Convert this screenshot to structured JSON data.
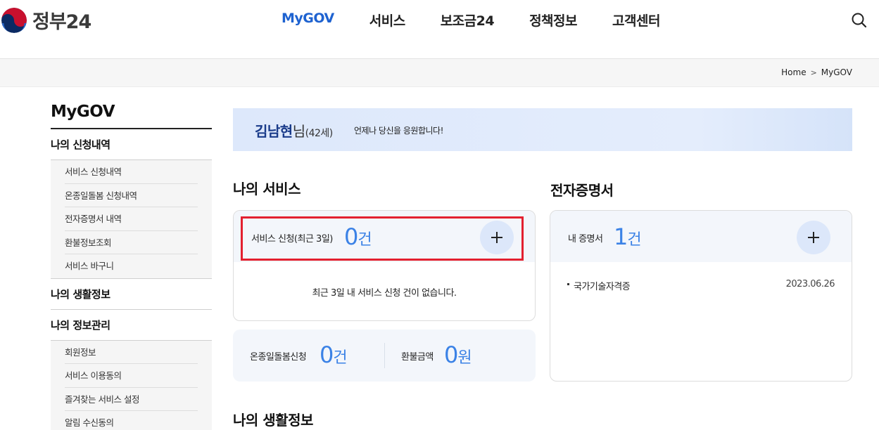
{
  "header": {
    "logo_text": "정부24",
    "nav": [
      "MyGOV",
      "서비스",
      "보조금24",
      "정책정보",
      "고객센터"
    ],
    "active_nav": "MyGOV",
    "search_icon": "search-icon"
  },
  "breadcrumb": {
    "home": "Home",
    "current": "MyGOV"
  },
  "sidebar": {
    "title": "MyGOV",
    "cat1": {
      "label": "나의 신청내역",
      "items": [
        "서비스 신청내역",
        "온종일돌봄 신청내역",
        "전자증명서 내역",
        "환불정보조회",
        "서비스 바구니"
      ]
    },
    "cat2": {
      "label": "나의 생활정보"
    },
    "cat3": {
      "label": "나의 정보관리",
      "items": [
        "회원정보",
        "서비스 이용동의",
        "즐겨찾는 서비스 설정",
        "알림 수신동의"
      ]
    }
  },
  "welcome": {
    "name": "김남현",
    "suffix": "님",
    "age": "(42세)",
    "message": "언제나 당신을 응원합니다!"
  },
  "my_services": {
    "title": "나의 서비스",
    "label": "서비스 신청(최근 3일)",
    "count": "0",
    "unit": "건",
    "empty_message": "최근 3일 내 서비스 신청 건이 없습니다."
  },
  "stats": {
    "care_label": "온종일돌봄신청",
    "care_count": "0",
    "care_unit": "건",
    "refund_label": "환불금액",
    "refund_count": "0",
    "refund_unit": "원"
  },
  "certificates": {
    "title": "전자증명서",
    "label": "내 증명서",
    "count": "1",
    "unit": "건",
    "items": [
      {
        "name": "국가기술자격증",
        "date": "2023.06.26"
      }
    ]
  },
  "life_info": {
    "title": "나의 생활정보"
  },
  "colors": {
    "accent": "#1e62d0",
    "count_blue": "#3b82e6",
    "highlight_red": "#e3202f"
  }
}
